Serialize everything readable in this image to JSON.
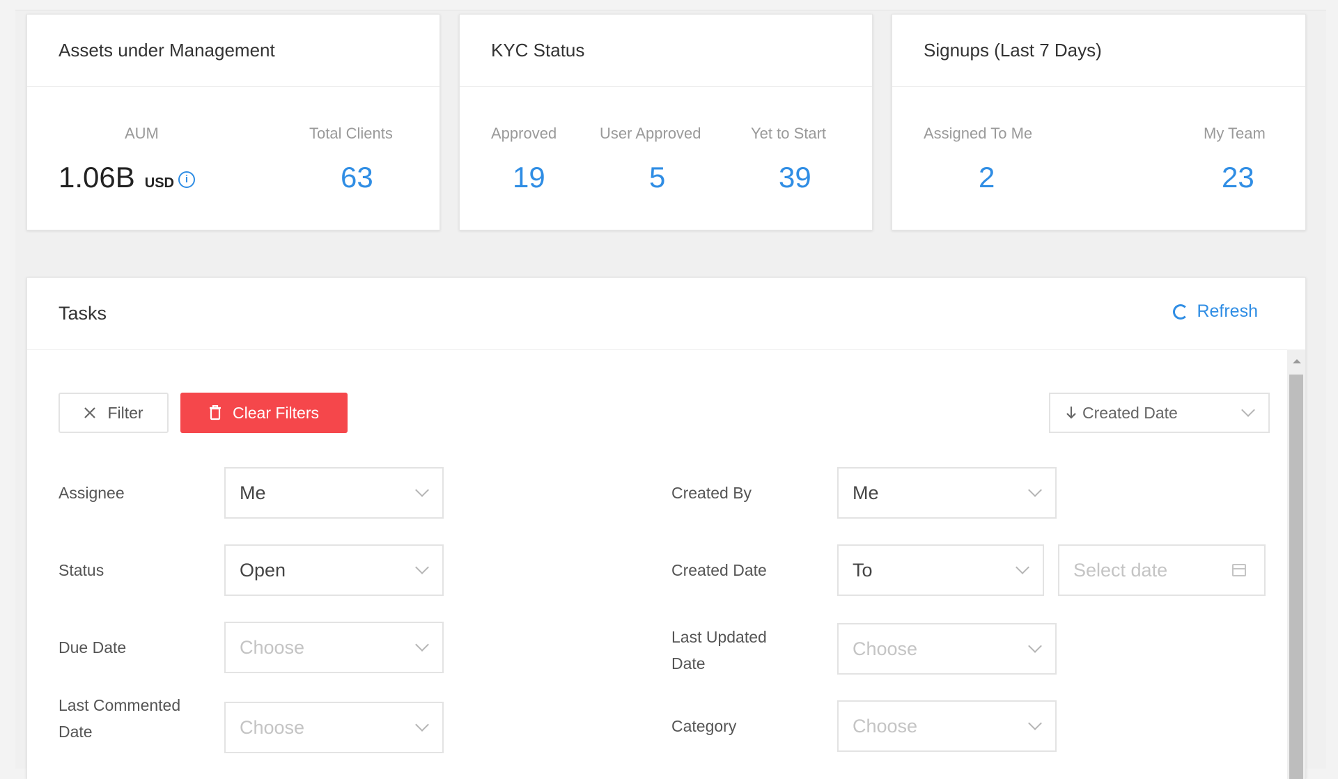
{
  "aum_card": {
    "title": "Assets under Management",
    "aum_label": "AUM",
    "aum_value": "1.06B",
    "aum_currency": "USD",
    "info_glyph": "i",
    "clients_label": "Total Clients",
    "clients_value": "63"
  },
  "kyc_card": {
    "title": "KYC Status",
    "approved_label": "Approved",
    "approved_value": "19",
    "user_approved_label": "User Approved",
    "user_approved_value": "5",
    "yet_to_start_label": "Yet to Start",
    "yet_to_start_value": "39"
  },
  "signups_card": {
    "title": "Signups (Last 7 Days)",
    "assigned_label": "Assigned To Me",
    "assigned_value": "2",
    "team_label": "My Team",
    "team_value": "23"
  },
  "tasks": {
    "title": "Tasks",
    "refresh_label": "Refresh",
    "filter_label": "Filter",
    "clear_filters_label": "Clear Filters",
    "sort_label": "Created Date",
    "filters": {
      "assignee_label": "Assignee",
      "assignee_value": "Me",
      "status_label": "Status",
      "status_value": "Open",
      "due_date_label": "Due Date",
      "due_date_placeholder": "Choose",
      "last_commented_label_1": "Last Commented",
      "last_commented_label_2": "Date",
      "last_commented_placeholder": "Choose",
      "created_by_label": "Created By",
      "created_by_value": "Me",
      "created_date_label": "Created Date",
      "created_date_value": "To",
      "created_date_placeholder": "Select date",
      "last_updated_label_1": "Last Updated",
      "last_updated_label_2": "Date",
      "last_updated_placeholder": "Choose",
      "category_label": "Category",
      "category_placeholder": "Choose"
    }
  },
  "icons": {
    "filter": "close-icon",
    "clear": "trash-icon",
    "sort": "arrow-down-icon",
    "refresh": "refresh-icon"
  },
  "colors": {
    "accent": "#2f8de4",
    "danger": "#f5474b"
  }
}
